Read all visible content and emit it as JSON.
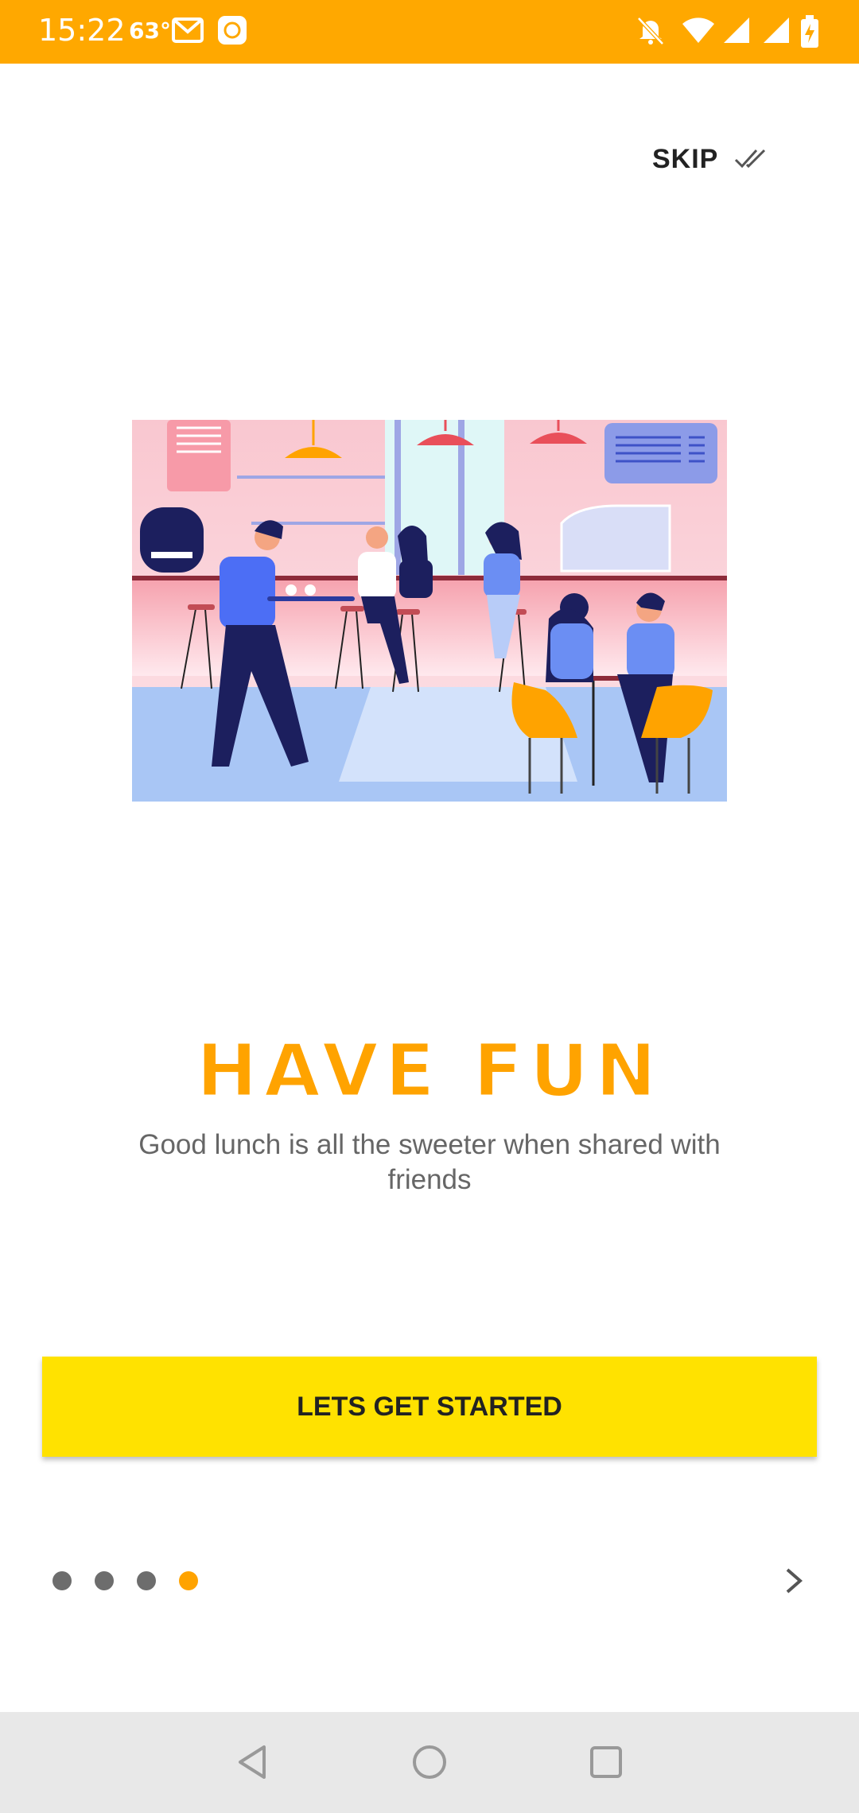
{
  "status_bar": {
    "time": "15:22",
    "temperature": "63°",
    "background": "#FFA800",
    "left_icons": [
      "gmail-icon",
      "mi-app-icon"
    ],
    "right_icons": [
      "bell-muted-icon",
      "wifi-icon",
      "signal-icon",
      "signal-icon",
      "battery-charging-icon"
    ]
  },
  "header": {
    "skip_label": "SKIP",
    "skip_icon": "double-check-icon"
  },
  "onboarding": {
    "title": "HAVE FUN",
    "subtitle": "Good lunch is all the sweeter when shared with friends",
    "cta_label": "LETS GET STARTED",
    "title_color": "#FFA300",
    "cta_color": "#FFE200"
  },
  "pager": {
    "page_count": 4,
    "current_page": 4,
    "active_color": "#FFA300",
    "inactive_color": "#6d6d6d",
    "next_icon": "chevron-right-icon"
  },
  "nav_bar": {
    "buttons": [
      "back-icon",
      "home-icon",
      "recents-icon"
    ]
  }
}
